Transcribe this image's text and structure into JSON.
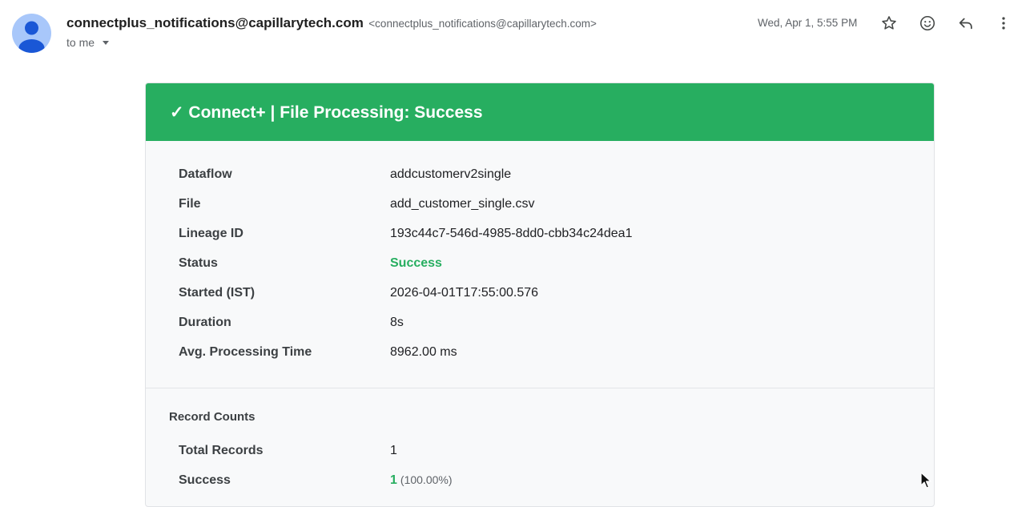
{
  "email": {
    "sender_name": "connectplus_notifications@capillarytech.com",
    "sender_email": "<connectplus_notifications@capillarytech.com>",
    "recipient": "to me",
    "timestamp": "Wed, Apr 1, 5:55 PM",
    "icons": [
      "star-icon",
      "emoji-icon",
      "reply-icon",
      "more-vert-icon"
    ]
  },
  "card": {
    "banner_title": "✓ Connect+ | File Processing: Success",
    "banner_color": "#27ae60",
    "details": [
      {
        "label": "Dataflow",
        "value": "addcustomerv2single"
      },
      {
        "label": "File",
        "value": "add_customer_single.csv"
      },
      {
        "label": "Lineage ID",
        "value": "193c44c7-546d-4985-8dd0-cbb34c24dea1"
      },
      {
        "label": "Status",
        "value": "Success"
      },
      {
        "label": "Started (IST)",
        "value": "2026-04-01T17:55:00.576"
      },
      {
        "label": "Duration",
        "value": "8s"
      },
      {
        "label": "Avg. Processing Time",
        "value": "8962.00 ms"
      }
    ],
    "record_counts": {
      "title": "Record Counts",
      "total_label": "Total Records",
      "total_value": "1",
      "success_label": "Success",
      "success_value": "1",
      "success_pct": "(100.00%)"
    }
  }
}
